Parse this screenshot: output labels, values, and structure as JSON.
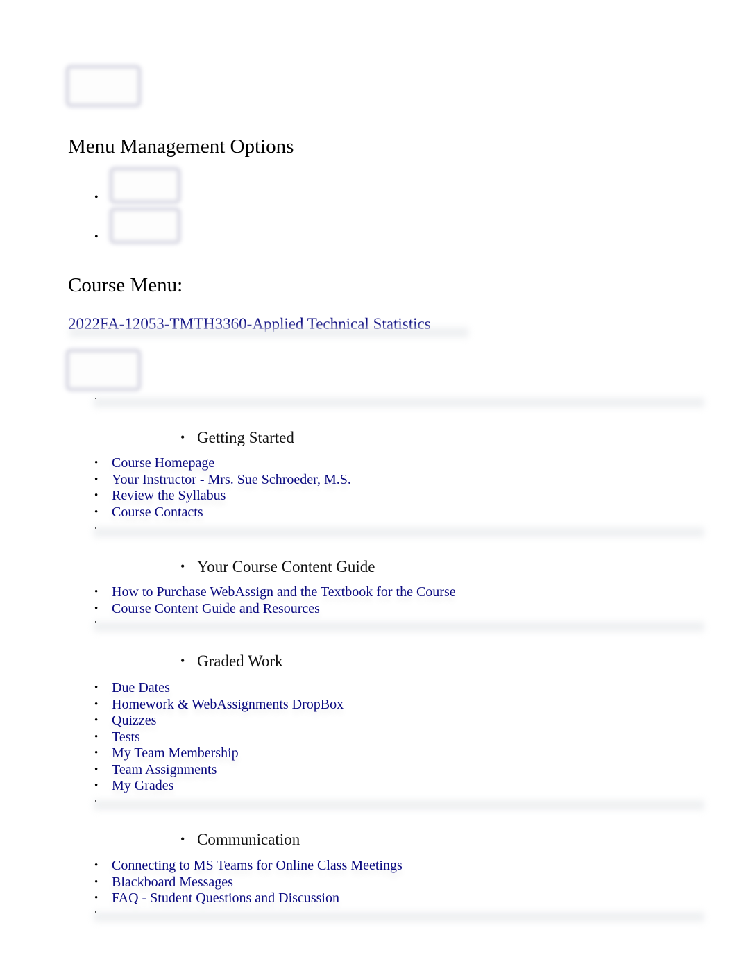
{
  "menu_management": {
    "heading": "Menu Management Options"
  },
  "course_menu": {
    "heading": "Course Menu:",
    "course_title": "2022FA-12053-TMTH3360-Applied Technical Statistics",
    "bullet": "•"
  },
  "sections": [
    {
      "title": "Getting Started",
      "links": [
        "Course Homepage",
        "Your Instructor - Mrs. Sue Schroeder, M.S.",
        "Review the Syllabus",
        "Course Contacts"
      ]
    },
    {
      "title": "Your Course Content Guide",
      "links": [
        "How to Purchase WebAssign and the Textbook for the Course",
        "Course Content Guide and Resources"
      ]
    },
    {
      "title": "Graded Work",
      "links": [
        "Due Dates",
        "Homework & WebAssignments DropBox",
        "Quizzes",
        "Tests",
        "My Team Membership",
        "Team Assignments",
        "My Grades"
      ]
    },
    {
      "title": "Communication",
      "links": [
        "Connecting to MS Teams for Online Class Meetings",
        "Blackboard Messages",
        "FAQ - Student Questions and Discussion"
      ]
    }
  ]
}
